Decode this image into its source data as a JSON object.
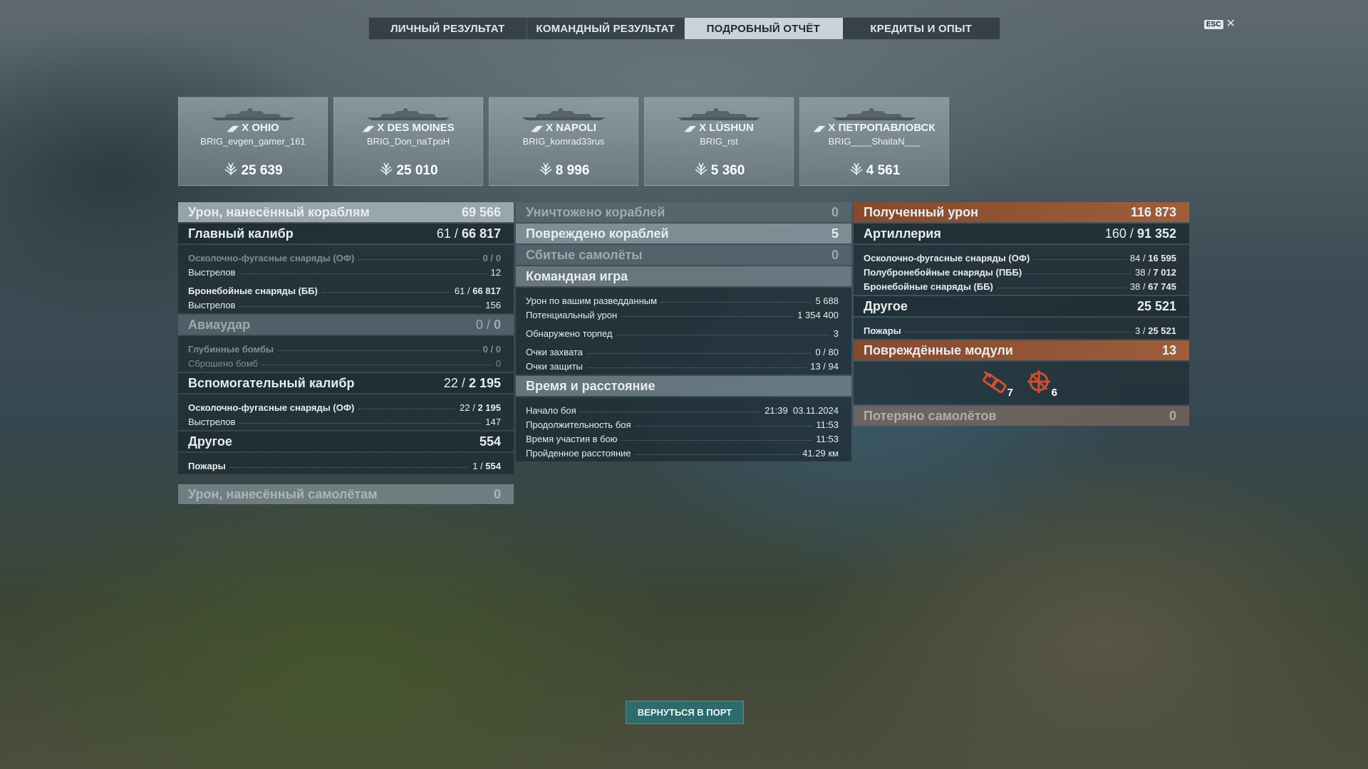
{
  "tabs": [
    {
      "label": "ЛИЧНЫЙ РЕЗУЛЬТАТ",
      "active": false
    },
    {
      "label": "КОМАНДНЫЙ РЕЗУЛЬТАТ",
      "active": false
    },
    {
      "label": "ПОДРОБНЫЙ ОТЧЁТ",
      "active": true
    },
    {
      "label": "КРЕДИТЫ И ОПЫТ",
      "active": false
    }
  ],
  "esc": {
    "key": "ESC",
    "close": "✕"
  },
  "ships": [
    {
      "tier": "X",
      "name": "OHIO",
      "player": "BRIG_evgen_gamer_161",
      "damage": "25 639",
      "icon": "battleship-icon"
    },
    {
      "tier": "X",
      "name": "DES MOINES",
      "player": "BRIG_Don_naTpoH",
      "damage": "25 010",
      "icon": "cruiser-icon"
    },
    {
      "tier": "X",
      "name": "NAPOLI",
      "player": "BRIG_komrad33rus",
      "damage": "8 996",
      "icon": "cruiser-icon"
    },
    {
      "tier": "X",
      "name": "LÜSHUN",
      "player": "BRIG_rst",
      "damage": "5 360",
      "icon": "destroyer-icon"
    },
    {
      "tier": "X",
      "name": "ПЕТРОПАВЛОВСК",
      "player": "BRIG____ShaitaN___",
      "damage": "4 561",
      "icon": "cruiser-icon"
    }
  ],
  "left": {
    "ship_damage": {
      "label": "Урон, нанесённый кораблям",
      "value": "69 566"
    },
    "main_battery": {
      "label": "Главный калибр",
      "hits": "61",
      "sep": "/",
      "dmg": "66 817"
    },
    "main_rows": [
      {
        "label": "Осколочно-фугасные снаряды (ОФ)",
        "hits": "0",
        "sep": "/",
        "dmg": "0"
      },
      {
        "label": "Выстрелов",
        "value": "12"
      },
      {
        "label": "Бронебойные снаряды (ББ)",
        "hits": "61",
        "sep": "/",
        "dmg": "66 817"
      },
      {
        "label": "Выстрелов",
        "value": "156"
      }
    ],
    "airstrike": {
      "label": "Авиаудар",
      "hits": "0",
      "sep": "/",
      "dmg": "0"
    },
    "air_rows": [
      {
        "label": "Глубинные бомбы",
        "hits": "0",
        "sep": "/",
        "dmg": "0"
      },
      {
        "label": "Сброшено бомб",
        "value": "0"
      }
    ],
    "secondary": {
      "label": "Вспомогательный калибр",
      "hits": "22",
      "sep": "/",
      "dmg": "2 195"
    },
    "sec_rows": [
      {
        "label": "Осколочно-фугасные снаряды (ОФ)",
        "hits": "22",
        "sep": "/",
        "dmg": "2 195"
      },
      {
        "label": "Выстрелов",
        "value": "147"
      }
    ],
    "other": {
      "label": "Другое",
      "value": "554"
    },
    "other_rows": [
      {
        "label": "Пожары",
        "hits": "1",
        "sep": "/",
        "dmg": "554"
      }
    ],
    "plane_damage": {
      "label": "Урон, нанесённый самолётам",
      "value": "0"
    }
  },
  "middle": {
    "destroyed": {
      "label": "Уничтожено кораблей",
      "value": "0"
    },
    "damaged": {
      "label": "Повреждено кораблей",
      "value": "5"
    },
    "planes_shot": {
      "label": "Сбитые самолёты",
      "value": "0"
    },
    "team_game": {
      "label": "Командная игра"
    },
    "team_rows": [
      {
        "label": "Урон по вашим разведданным",
        "value": "5 688"
      },
      {
        "label": "Потенциальный урон",
        "value": "1 354 400"
      },
      {
        "label": "Обнаружено торпед",
        "value": "3"
      },
      {
        "label": "Очки захвата",
        "value": "0 / 80"
      },
      {
        "label": "Очки защиты",
        "value": "13 / 94"
      }
    ],
    "time": {
      "label": "Время и расстояние"
    },
    "time_rows": [
      {
        "label": "Начало боя",
        "value": "21:39  03.11.2024"
      },
      {
        "label": "Продолжительность боя",
        "value": "11:53"
      },
      {
        "label": "Время участия в бою",
        "value": "11:53"
      },
      {
        "label": "Пройденное расстояние",
        "value": "41.29 км"
      }
    ]
  },
  "right": {
    "received": {
      "label": "Полученный урон",
      "value": "116 873"
    },
    "artillery": {
      "label": "Артиллерия",
      "hits": "160",
      "sep": "/",
      "dmg": "91 352"
    },
    "art_rows": [
      {
        "label": "Осколочно-фугасные снаряды (ОФ)",
        "hits": "84",
        "sep": "/",
        "dmg": "16 595"
      },
      {
        "label": "Полубронебойные снаряды (ПББ)",
        "hits": "38",
        "sep": "/",
        "dmg": "7 012"
      },
      {
        "label": "Бронебойные снаряды (ББ)",
        "hits": "38",
        "sep": "/",
        "dmg": "67 745"
      }
    ],
    "other": {
      "label": "Другое",
      "value": "25 521"
    },
    "other_rows": [
      {
        "label": "Пожары",
        "hits": "3",
        "sep": "/",
        "dmg": "25 521"
      }
    ],
    "modules": {
      "label": "Повреждённые модули",
      "value": "13",
      "items": [
        {
          "icon": "turret-module-icon",
          "count": "7"
        },
        {
          "icon": "steering-gear-icon",
          "count": "6"
        }
      ]
    },
    "planes_lost": {
      "label": "Потеряно самолётов",
      "value": "0"
    }
  },
  "back_button": "ВЕРНУТЬСЯ В ПОРТ",
  "colors": {
    "orange_header": "#a0603a",
    "button": "#2e6b6c",
    "active_tab": "#c9d3d8"
  }
}
